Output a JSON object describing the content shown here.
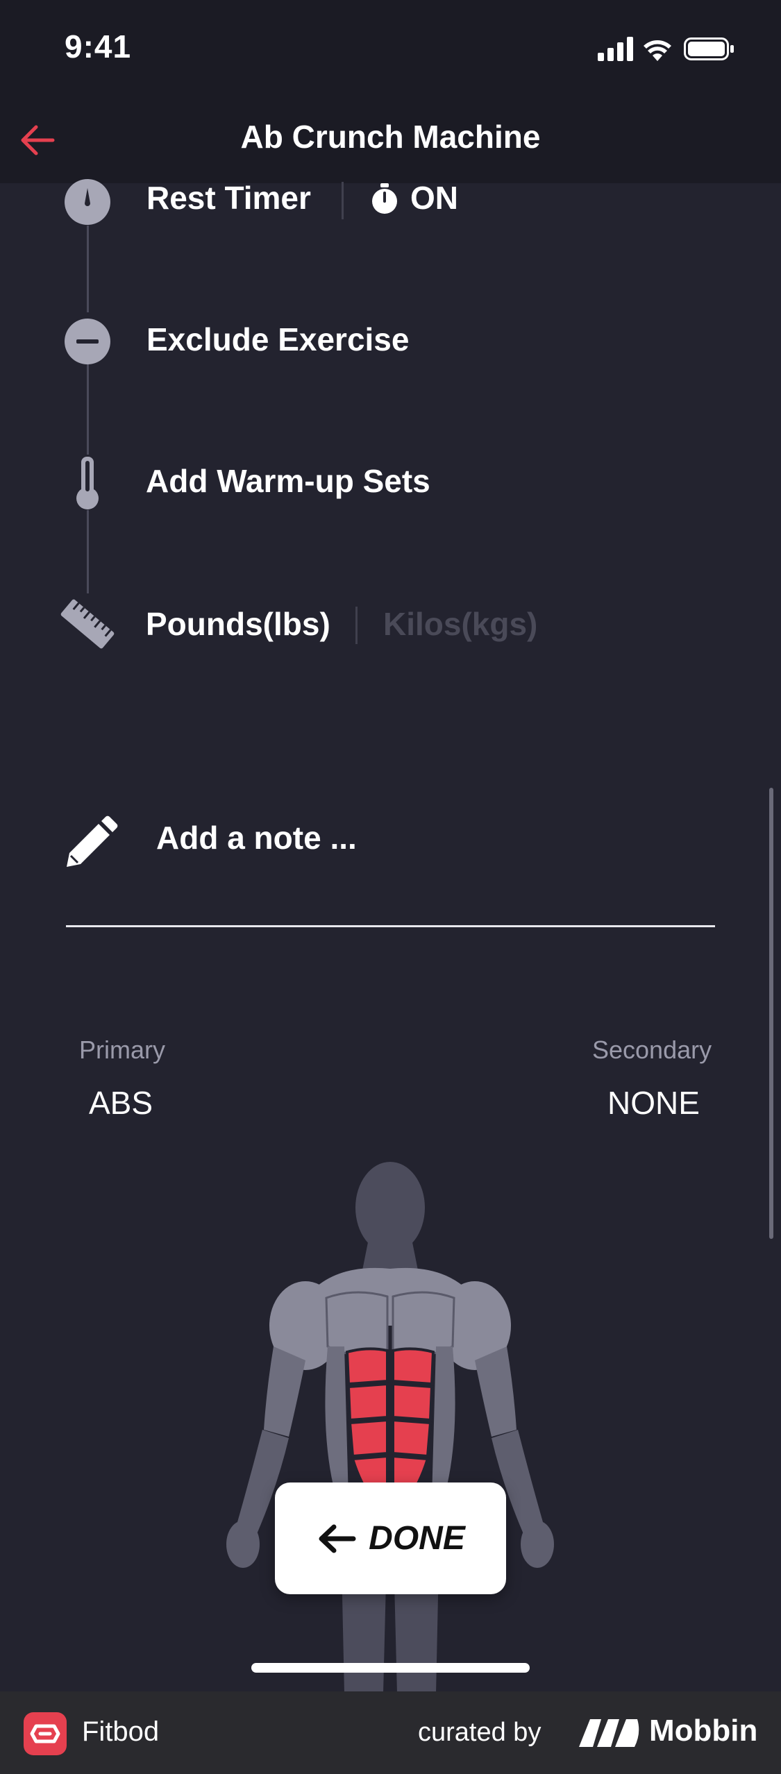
{
  "status": {
    "time": "9:41"
  },
  "nav": {
    "title": "Ab Crunch Machine"
  },
  "options": {
    "rest_timer": {
      "label": "Rest Timer",
      "state": "ON"
    },
    "exclude": {
      "label": "Exclude Exercise"
    },
    "warmup": {
      "label": "Add Warm-up Sets"
    },
    "units": {
      "pounds": "Pounds(lbs)",
      "kilos": "Kilos(kgs)",
      "selected": "Pounds(lbs)"
    }
  },
  "note": {
    "placeholder": "Add a note ..."
  },
  "muscles": {
    "primary_label": "Primary",
    "primary_value": "ABS",
    "secondary_label": "Secondary",
    "secondary_value": "NONE"
  },
  "done_button": {
    "label": "DONE"
  },
  "footer": {
    "app_name": "Fitbod",
    "curated_by": "curated by",
    "brand": "Mobbin"
  },
  "colors": {
    "accent": "#e5404f",
    "background": "#23232f",
    "header": "#1b1b24"
  }
}
